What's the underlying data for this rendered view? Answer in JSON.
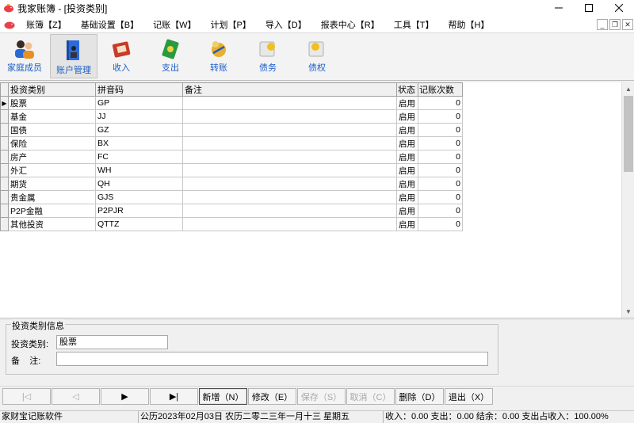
{
  "window": {
    "title": "我家账簿 - [投资类别]"
  },
  "menu": [
    "账簿【Z】",
    "基础设置【B】",
    "记账【W】",
    "计划【P】",
    "导入【D】",
    "报表中心【R】",
    "工具【T】",
    "帮助【H】"
  ],
  "toolbar": [
    {
      "label": "家庭成员",
      "icon": "family-members-icon"
    },
    {
      "label": "账户管理",
      "icon": "account-book-icon",
      "active": true
    },
    {
      "label": "收入",
      "icon": "income-icon"
    },
    {
      "label": "支出",
      "icon": "expense-icon"
    },
    {
      "label": "转账",
      "icon": "transfer-icon"
    },
    {
      "label": "债务",
      "icon": "debt-icon"
    },
    {
      "label": "债权",
      "icon": "credit-icon"
    }
  ],
  "grid": {
    "columns": [
      "投资类别",
      "拼音码",
      "备注",
      "状态",
      "记账次数"
    ],
    "rows": [
      {
        "name": "股票",
        "code": "GP",
        "note": "",
        "status": "启用",
        "count": "0"
      },
      {
        "name": "基金",
        "code": "JJ",
        "note": "",
        "status": "启用",
        "count": "0"
      },
      {
        "name": "国债",
        "code": "GZ",
        "note": "",
        "status": "启用",
        "count": "0"
      },
      {
        "name": "保险",
        "code": "BX",
        "note": "",
        "status": "启用",
        "count": "0"
      },
      {
        "name": "房产",
        "code": "FC",
        "note": "",
        "status": "启用",
        "count": "0"
      },
      {
        "name": "外汇",
        "code": "WH",
        "note": "",
        "status": "启用",
        "count": "0"
      },
      {
        "name": "期货",
        "code": "QH",
        "note": "",
        "status": "启用",
        "count": "0"
      },
      {
        "name": "贵金属",
        "code": "GJS",
        "note": "",
        "status": "启用",
        "count": "0"
      },
      {
        "name": "P2P金融",
        "code": "P2PJR",
        "note": "",
        "status": "启用",
        "count": "0"
      },
      {
        "name": "其他投资",
        "code": "QTTZ",
        "note": "",
        "status": "启用",
        "count": "0"
      }
    ],
    "current_row": 0
  },
  "detail": {
    "group_title": "投资类别信息",
    "category_label": "投资类别:",
    "category_value": "股票",
    "note_label": "备    注:",
    "note_value": ""
  },
  "nav_buttons": [
    {
      "label": "|◁",
      "enabled": false
    },
    {
      "label": "◁",
      "enabled": false
    },
    {
      "label": "▶",
      "enabled": true
    },
    {
      "label": "▶|",
      "enabled": true
    },
    {
      "label": "新增（N）",
      "enabled": true,
      "focused": true
    },
    {
      "label": "修改（E）",
      "enabled": true
    },
    {
      "label": "保存（S）",
      "enabled": false
    },
    {
      "label": "取消（C）",
      "enabled": false
    },
    {
      "label": "删除（D）",
      "enabled": true
    },
    {
      "label": "退出（X）",
      "enabled": true
    }
  ],
  "status": {
    "app": "家财宝记账软件",
    "date": "公历2023年02月03日 农历二零二三年一月十三  星期五",
    "summary": "收入：0.00 支出：0.00 结余：0.00 支出占收入：100.00%"
  }
}
